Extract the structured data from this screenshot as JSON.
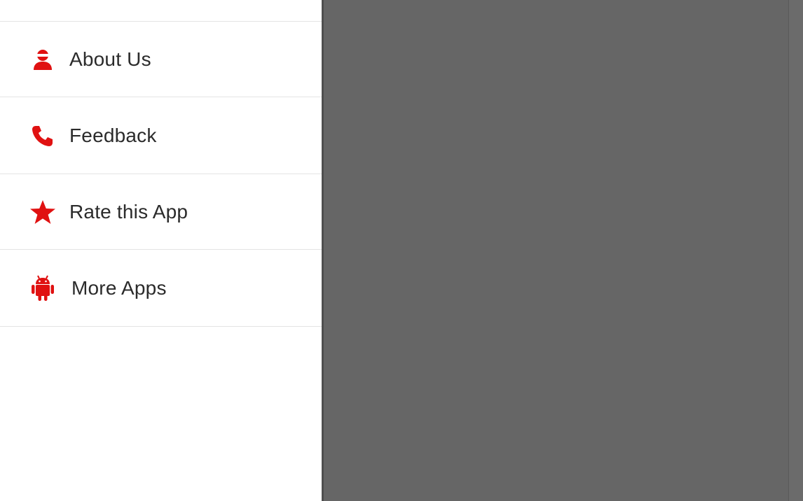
{
  "accent_color": "#e01111",
  "drawer": {
    "items": [
      {
        "label": "About Us",
        "icon": "person-icon"
      },
      {
        "label": "Feedback",
        "icon": "phone-icon"
      },
      {
        "label": "Rate this App",
        "icon": "star-icon"
      },
      {
        "label": "More Apps",
        "icon": "android-icon"
      }
    ]
  }
}
